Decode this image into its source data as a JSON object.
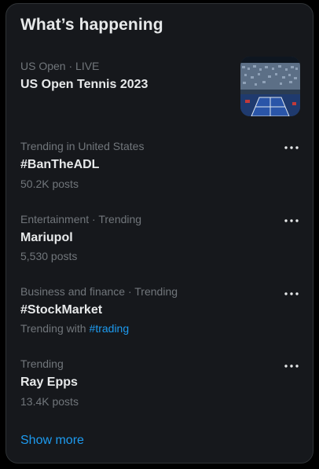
{
  "panel": {
    "title": "What’s happening"
  },
  "trends": [
    {
      "meta": "US Open · LIVE",
      "headline": "US Open Tennis 2023",
      "has_thumbnail": true,
      "thumbnail_icon": "tennis-stadium-image"
    },
    {
      "meta": "Trending in United States",
      "headline": "#BanTheADL",
      "sub": "50.2K posts",
      "more_icon": "more-horizontal-icon"
    },
    {
      "meta": "Entertainment · Trending",
      "headline": "Mariupol",
      "sub": "5,530 posts",
      "more_icon": "more-horizontal-icon"
    },
    {
      "meta": "Business and finance · Trending",
      "headline": "#StockMarket",
      "sub": "Trending with",
      "sub_link": "#trading",
      "more_icon": "more-horizontal-icon"
    },
    {
      "meta": "Trending",
      "headline": "Ray Epps",
      "sub": "13.4K posts",
      "more_icon": "more-horizontal-icon"
    }
  ],
  "footer": {
    "show_more_label": "Show more"
  },
  "colors": {
    "background": "#000000",
    "panel_bg": "#16181c",
    "text_primary": "#e7e9ea",
    "text_secondary": "#71767b",
    "accent": "#1d9bf0"
  }
}
